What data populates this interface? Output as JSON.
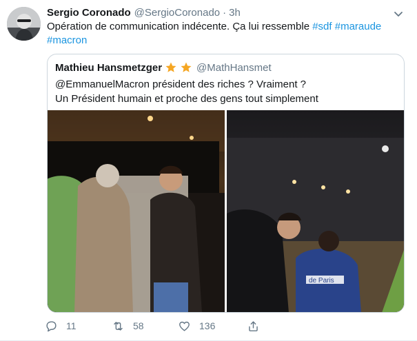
{
  "tweet": {
    "author": {
      "display_name": "Sergio Coronado",
      "handle": "@SergioCoronado",
      "avatar": "avatar-photo"
    },
    "separator": "·",
    "timestamp": "3h",
    "text_plain": "Opération de communication indécente. Ça lui ressemble ",
    "hashtags": [
      "#sdf",
      "#maraude",
      "#macron"
    ],
    "menu_icon": "chevron-down-icon"
  },
  "quoted_tweet": {
    "display_name": "Mathieu Hansmetzger",
    "badges": [
      "star-icon",
      "star-icon"
    ],
    "badge_color": "#f5a623",
    "handle": "@MathHansmet",
    "lines": [
      "@EmmanuelMacron président des riches ? Vraiment ?",
      "Un Président humain et proche des gens tout simplement"
    ],
    "media": [
      {
        "icon": "photo-night-street-left"
      },
      {
        "icon": "photo-night-street-right",
        "text": "de Paris"
      }
    ]
  },
  "actions": {
    "reply": {
      "icon": "reply-icon",
      "count": "11"
    },
    "retweet": {
      "icon": "retweet-icon",
      "count": "58"
    },
    "like": {
      "icon": "heart-icon",
      "count": "136"
    },
    "share": {
      "icon": "share-icon"
    }
  },
  "colors": {
    "link": "#1b95e0",
    "secondary": "#657786",
    "border": "#ccd6dd"
  }
}
